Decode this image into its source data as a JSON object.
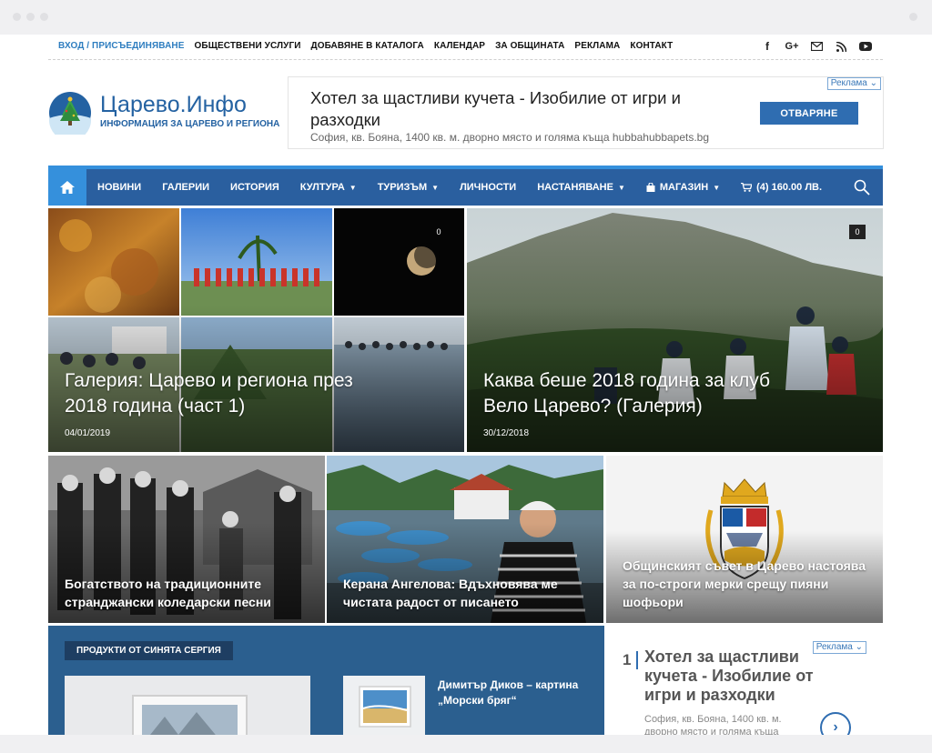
{
  "topbar": {
    "login": "ВХОД / ПРИСЪЕДИНЯВАНЕ",
    "links": [
      "ОБЩЕСТВЕНИ УСЛУГИ",
      "ДОБАВЯНЕ В КАТАЛОГА",
      "КАЛЕНДАР",
      "ЗА ОБЩИНАТА",
      "РЕКЛАМА",
      "КОНТАКТ"
    ],
    "social_icons": [
      "facebook-icon",
      "google-plus-icon",
      "mail-icon",
      "rss-icon",
      "youtube-icon"
    ]
  },
  "logo": {
    "brand": "Царево.Инфо",
    "tagline": "ИНФОРМАЦИЯ ЗА ЦАРЕВО И РЕГИОНА"
  },
  "ad_top": {
    "badge": "Реклама ⌄",
    "title": "Хотел за щастливи кучета - Изобилие от игри и разходки",
    "description": "София, кв. Бояна, 1400 кв. м. дворно място и голяма къща hubbahubbapets.bg",
    "button": "ОТВАРЯНЕ"
  },
  "nav": {
    "items": [
      {
        "label": "НОВИНИ",
        "dropdown": false
      },
      {
        "label": "ГАЛЕРИИ",
        "dropdown": false
      },
      {
        "label": "ИСТОРИЯ",
        "dropdown": false
      },
      {
        "label": "КУЛТУРА",
        "dropdown": true
      },
      {
        "label": "ТУРИЗЪМ",
        "dropdown": true
      },
      {
        "label": "ЛИЧНОСТИ",
        "dropdown": false
      },
      {
        "label": "НАСТАНЯВАНЕ",
        "dropdown": true
      },
      {
        "label": "МАГАЗИН",
        "dropdown": true
      },
      {
        "label": "(4) 160.00 ЛВ.",
        "dropdown": false
      }
    ]
  },
  "featured": [
    {
      "headline": "Галерия: Царево и региона през 2018 година (част 1)",
      "date": "04/01/2019",
      "comments": "0"
    },
    {
      "headline": "Каква беше 2018 година за клуб Вело Царево? (Галерия)",
      "date": "30/12/2018",
      "comments": "0"
    }
  ],
  "secondary": [
    {
      "headline": "Богатството на традиционните странджански коледарски песни"
    },
    {
      "headline": "Керана Ангелова: Вдъхновява ме чистата радост от писането"
    },
    {
      "headline": "Общинският съвет в Царево настоява за по-строги мерки срещу пияни шофьори"
    }
  ],
  "products": {
    "label": "ПРОДУКТИ ОТ СИНЯТА СЕРГИЯ",
    "item_title": "Димитър Диков – картина „Морски бряг“"
  },
  "ad_side": {
    "badge": "Реклама ⌄",
    "number": "1",
    "title": "Хотел за щастливи кучета - Изобилие от игри и разходки",
    "description": "София, кв. Бояна, 1400 кв. м. дворно място и голяма къща"
  }
}
